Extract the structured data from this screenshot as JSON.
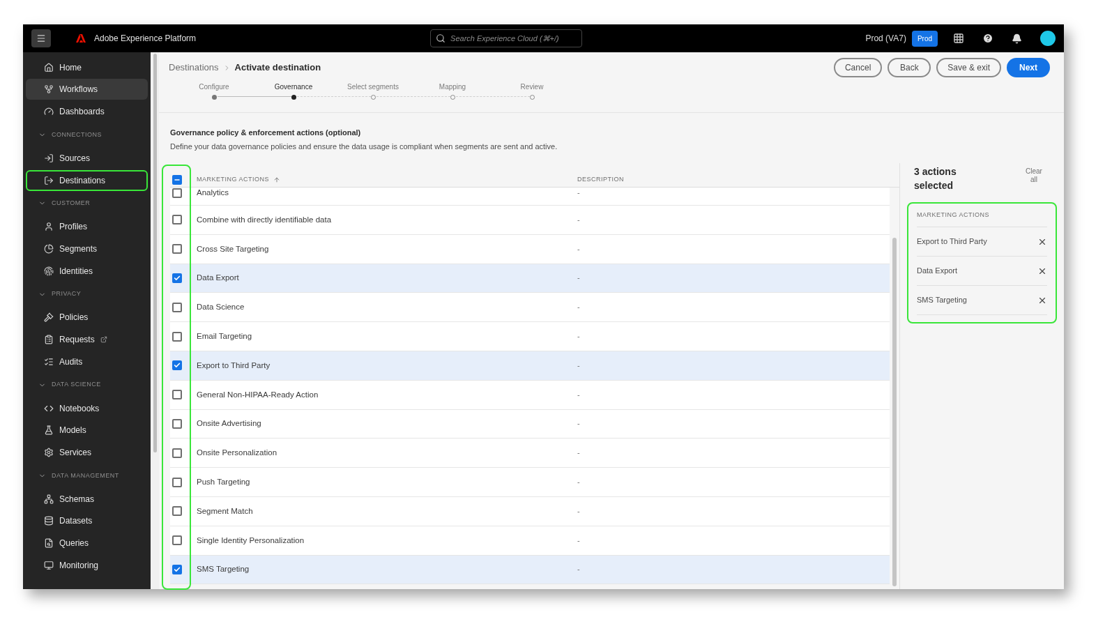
{
  "top_bar": {
    "app_name": "Adobe Experience Platform",
    "search": {
      "placeholder": "Search Experience Cloud (⌘+/)"
    },
    "environment": "Prod (VA7)",
    "env_badge": "Prod"
  },
  "sidebar": {
    "items": [
      {
        "kind": "item",
        "label": "Home",
        "selected": false,
        "highlighted": false
      },
      {
        "kind": "item",
        "label": "Workflows",
        "selected": true,
        "highlighted": false
      },
      {
        "kind": "item",
        "label": "Dashboards",
        "selected": false,
        "highlighted": false
      },
      {
        "kind": "section",
        "label": "CONNECTIONS",
        "expanded": true
      },
      {
        "kind": "item",
        "label": "Sources",
        "selected": false,
        "highlighted": false
      },
      {
        "kind": "item",
        "label": "Destinations",
        "selected": false,
        "highlighted": true
      },
      {
        "kind": "section",
        "label": "CUSTOMER",
        "expanded": true
      },
      {
        "kind": "item",
        "label": "Profiles",
        "selected": false,
        "highlighted": false
      },
      {
        "kind": "item",
        "label": "Segments",
        "selected": false,
        "highlighted": false
      },
      {
        "kind": "item",
        "label": "Identities",
        "selected": false,
        "highlighted": false
      },
      {
        "kind": "section",
        "label": "PRIVACY",
        "expanded": true
      },
      {
        "kind": "item",
        "label": "Policies",
        "selected": false,
        "highlighted": false
      },
      {
        "kind": "item",
        "label": "Requests",
        "selected": false,
        "highlighted": false,
        "external": true
      },
      {
        "kind": "item",
        "label": "Audits",
        "selected": false,
        "highlighted": false
      },
      {
        "kind": "section",
        "label": "DATA SCIENCE",
        "expanded": true
      },
      {
        "kind": "item",
        "label": "Notebooks",
        "selected": false,
        "highlighted": false
      },
      {
        "kind": "item",
        "label": "Models",
        "selected": false,
        "highlighted": false
      },
      {
        "kind": "item",
        "label": "Services",
        "selected": false,
        "highlighted": false
      },
      {
        "kind": "section",
        "label": "DATA MANAGEMENT",
        "expanded": true
      },
      {
        "kind": "item",
        "label": "Schemas",
        "selected": false,
        "highlighted": false
      },
      {
        "kind": "item",
        "label": "Datasets",
        "selected": false,
        "highlighted": false
      },
      {
        "kind": "item",
        "label": "Queries",
        "selected": false,
        "highlighted": false
      },
      {
        "kind": "item",
        "label": "Monitoring",
        "selected": false,
        "highlighted": false
      }
    ]
  },
  "breadcrumb": [
    {
      "label": "Destinations",
      "current": false
    },
    {
      "label": "Activate destination",
      "current": true
    }
  ],
  "buttons": [
    {
      "label": "Cancel",
      "kind": "secondary"
    },
    {
      "label": "Back",
      "kind": "secondary"
    },
    {
      "label": "Save & exit",
      "kind": "secondary"
    },
    {
      "label": "Next",
      "kind": "primary"
    }
  ],
  "steps": [
    {
      "label": "Configure",
      "completed": true,
      "selected": false
    },
    {
      "label": "Governance",
      "completed": false,
      "selected": true
    },
    {
      "label": "Select segments",
      "completed": false,
      "selected": false
    },
    {
      "label": "Mapping",
      "completed": false,
      "selected": false
    },
    {
      "label": "Review",
      "completed": false,
      "selected": false
    }
  ],
  "section": {
    "title": "Governance policy & enforcement actions (optional)",
    "description": "Define your data governance policies and ensure the data usage is compliant when segments are sent and active."
  },
  "table": {
    "select_all_indeterminate": true,
    "checkbox_column_highlighted": true,
    "columns": [
      {
        "label": "MARKETING ACTIONS",
        "sort_ascending": true
      },
      {
        "label": "DESCRIPTION"
      }
    ],
    "rows": [
      {
        "name": "Analytics",
        "description": "-",
        "checked": false,
        "partial": true
      },
      {
        "name": "Combine with directly identifiable data",
        "description": "-",
        "checked": false,
        "partial": false
      },
      {
        "name": "Cross Site Targeting",
        "description": "-",
        "checked": false,
        "partial": false
      },
      {
        "name": "Data Export",
        "description": "-",
        "checked": true,
        "partial": false
      },
      {
        "name": "Data Science",
        "description": "-",
        "checked": false,
        "partial": false
      },
      {
        "name": "Email Targeting",
        "description": "-",
        "checked": false,
        "partial": false
      },
      {
        "name": "Export to Third Party",
        "description": "-",
        "checked": true,
        "partial": false
      },
      {
        "name": "General Non-HIPAA-Ready Action",
        "description": "-",
        "checked": false,
        "partial": false
      },
      {
        "name": "Onsite Advertising",
        "description": "-",
        "checked": false,
        "partial": false
      },
      {
        "name": "Onsite Personalization",
        "description": "-",
        "checked": false,
        "partial": false
      },
      {
        "name": "Push Targeting",
        "description": "-",
        "checked": false,
        "partial": false
      },
      {
        "name": "Segment Match",
        "description": "-",
        "checked": false,
        "partial": false
      },
      {
        "name": "Single Identity Personalization",
        "description": "-",
        "checked": false,
        "partial": false
      },
      {
        "name": "SMS Targeting",
        "description": "-",
        "checked": true,
        "partial": false
      }
    ]
  },
  "selection_panel": {
    "title": "3 actions selected",
    "clear": "Clear all",
    "highlighted": true,
    "group_label": "MARKETING ACTIONS",
    "items": [
      "Export to Third Party",
      "Data Export",
      "SMS Targeting"
    ]
  }
}
